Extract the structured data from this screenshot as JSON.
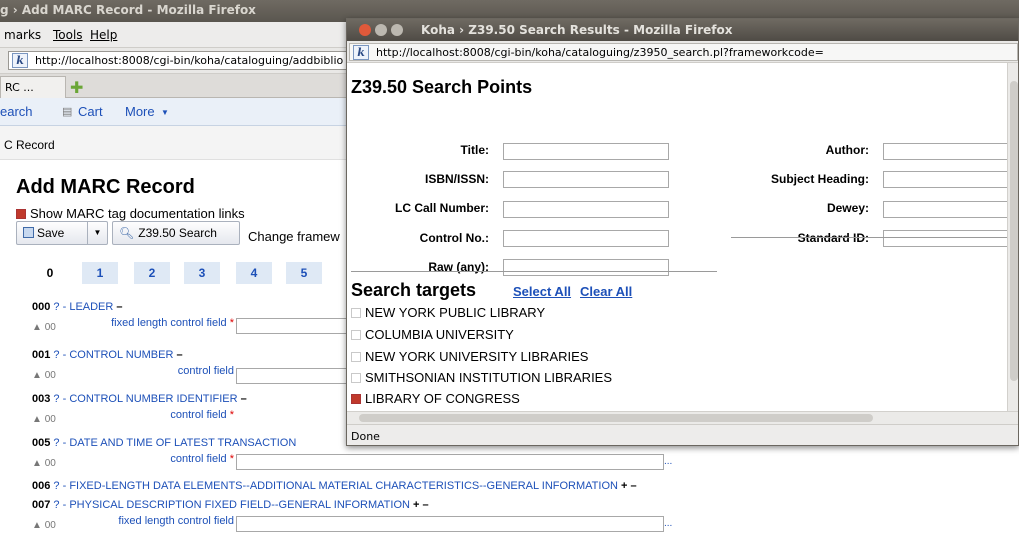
{
  "bg_window": {
    "title": "g › Add MARC Record - Mozilla Firefox",
    "menu": [
      "marks",
      "Tools",
      "Help"
    ],
    "url": "http://localhost:8008/cgi-bin/koha/cataloguing/addbiblio",
    "tab_label": "RC ...",
    "nav": {
      "search": "earch",
      "cart": "Cart",
      "more": "More"
    },
    "breadcrumb": "C Record",
    "page_title": "Add MARC Record",
    "show_doc_label": "Show MARC tag documentation links",
    "save_label": "Save",
    "z3950_label": "Z39.50 Search",
    "change_framework": "Change framew",
    "tag_tabs": [
      "0",
      "1",
      "2",
      "3",
      "4",
      "5"
    ],
    "fields": [
      {
        "tag": "000",
        "q": "?",
        "name": " - LEADER ",
        "suffix": "–"
      },
      {
        "tag": "001",
        "q": "?",
        "name": " - CONTROL NUMBER ",
        "suffix": "–"
      },
      {
        "tag": "003",
        "q": "?",
        "name": " - CONTROL NUMBER IDENTIFIER ",
        "suffix": "–"
      },
      {
        "tag": "005",
        "q": "?",
        "name": " - DATE AND TIME OF LATEST TRANSACTION",
        "suffix": ""
      },
      {
        "tag": "006",
        "q": "?",
        "name": " - FIXED-LENGTH DATA ELEMENTS--ADDITIONAL MATERIAL CHARACTERISTICS--GENERAL INFORMATION ",
        "suffix": "+ –"
      },
      {
        "tag": "007",
        "q": "?",
        "name": " - PHYSICAL DESCRIPTION FIXED FIELD--GENERAL INFORMATION ",
        "suffix": "+ –"
      }
    ],
    "subfields": [
      {
        "ind": "00",
        "label": "fixed length control field",
        "req": "*"
      },
      {
        "ind": "00",
        "label": "control field",
        "req": ""
      },
      {
        "ind": "00",
        "label": "control field",
        "req": "*"
      },
      {
        "ind": "00",
        "label": "control field",
        "req": "*"
      },
      {
        "ind": "00",
        "label": "fixed length control field",
        "req": ""
      }
    ],
    "ellipsis": "..."
  },
  "popup": {
    "title": "Koha › Z39.50 Search Results - Mozilla Firefox",
    "url": "http://localhost:8008/cgi-bin/koha/cataloguing/z3950_search.pl?frameworkcode=",
    "search_points_heading": "Z39.50 Search Points",
    "fields_left": [
      "Title:",
      "ISBN/ISSN:",
      "LC Call Number:",
      "Control No.:",
      "Raw (any):"
    ],
    "fields_right": [
      "Author:",
      "Subject Heading:",
      "Dewey:",
      "Standard ID:"
    ],
    "search_targets_heading": "Search targets",
    "select_all": "Select All",
    "clear_all": "Clear All",
    "targets": [
      {
        "name": "NEW YORK PUBLIC LIBRARY",
        "checked": false
      },
      {
        "name": "COLUMBIA UNIVERSITY",
        "checked": false
      },
      {
        "name": "NEW YORK UNIVERSITY LIBRARIES",
        "checked": false
      },
      {
        "name": "SMITHSONIAN INSTITUTION LIBRARIES",
        "checked": false
      },
      {
        "name": "LIBRARY OF CONGRESS",
        "checked": true
      }
    ],
    "status": "Done"
  }
}
